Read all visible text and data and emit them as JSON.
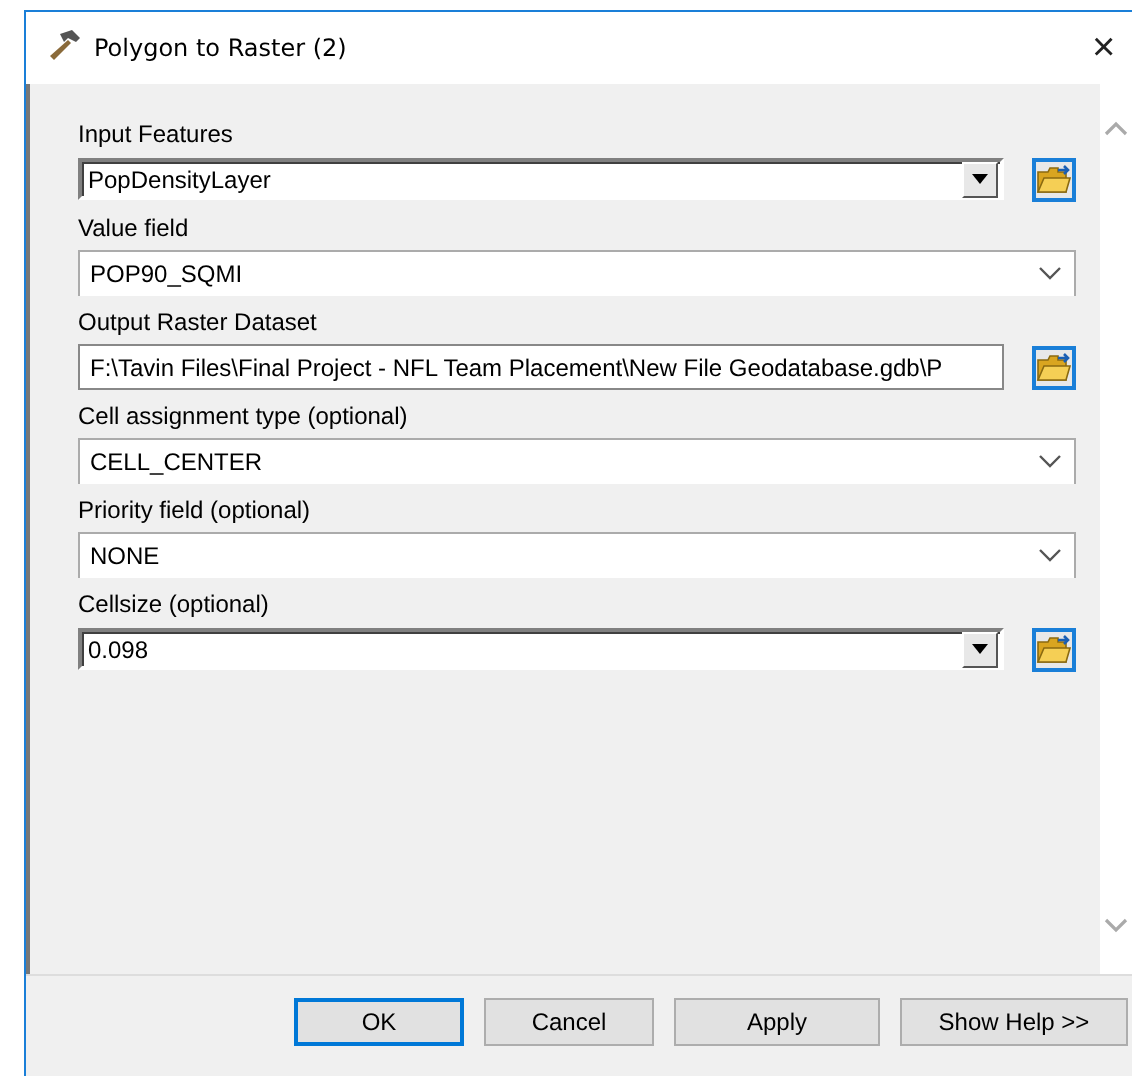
{
  "window": {
    "title": "Polygon to Raster (2)",
    "close": "×"
  },
  "fields": [
    {
      "label": "Input Features",
      "value": "PopDensityLayer",
      "kind": "combo"
    },
    {
      "label": "Value field",
      "value": "POP90_SQMI",
      "kind": "dropdown"
    },
    {
      "label": "Output Raster Dataset",
      "value": "F:\\Tavin Files\\Final Project - NFL Team Placement\\New File Geodatabase.gdb\\P",
      "kind": "text"
    },
    {
      "label": "Cell assignment type (optional)",
      "value": "CELL_CENTER",
      "kind": "dropdown"
    },
    {
      "label": "Priority field (optional)",
      "value": "NONE",
      "kind": "dropdown"
    },
    {
      "label": "Cellsize (optional)",
      "value": "0.098",
      "kind": "combo"
    }
  ],
  "buttons": [
    {
      "label": "OK",
      "default": true
    },
    {
      "label": "Cancel",
      "default": false
    },
    {
      "label": "Apply",
      "default": false
    },
    {
      "label": "Show Help >>",
      "default": false
    }
  ]
}
